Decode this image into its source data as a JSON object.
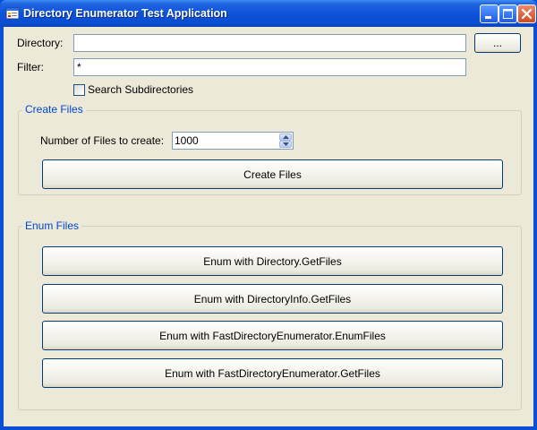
{
  "window": {
    "title": "Directory Enumerator Test Application",
    "icon": "app-window-icon",
    "controls": [
      "minimize-icon",
      "maximize-icon",
      "close-icon"
    ]
  },
  "directory": {
    "label": "Directory:",
    "value": "",
    "browse_label": "..."
  },
  "filter": {
    "label": "Filter:",
    "value": "*"
  },
  "search_subdirectories": {
    "label": "Search Subdirectories",
    "checked": false
  },
  "create_files_group": {
    "title": "Create Files",
    "count_label": "Number of Files to create:",
    "count_value": "1000",
    "create_button": "Create Files"
  },
  "enum_files_group": {
    "title": "Enum Files",
    "buttons": [
      "Enum with Directory.GetFiles",
      "Enum with DirectoryInfo.GetFiles",
      "Enum with FastDirectoryEnumerator.EnumFiles",
      "Enum with FastDirectoryEnumerator.GetFiles"
    ]
  },
  "colors": {
    "titlebar": "#0a4ed2",
    "client_bg": "#ece9d8",
    "group_title": "#0046d5",
    "button_border": "#003c74"
  }
}
